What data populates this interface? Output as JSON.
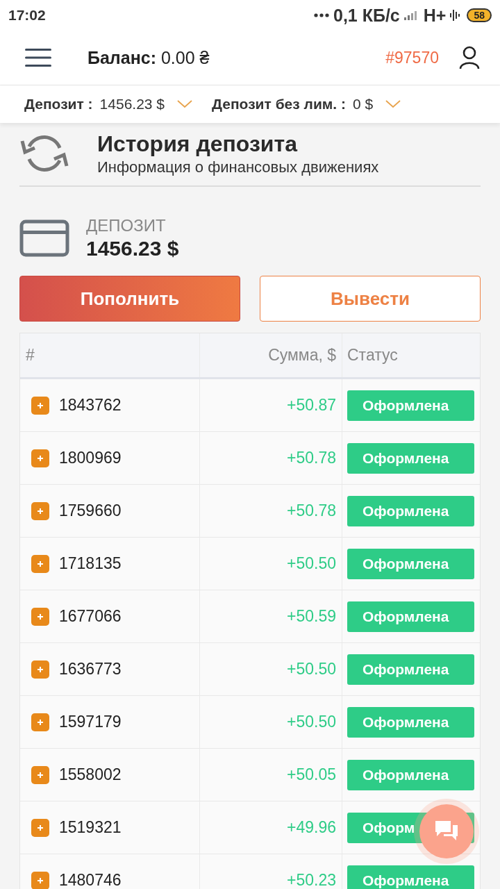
{
  "status_bar": {
    "time": "17:02",
    "speed": "0,1 КБ/с",
    "network": "H+",
    "battery": "58"
  },
  "header": {
    "balance_label": "Баланс:",
    "balance_value": "0.00 ₴",
    "account_id": "#97570"
  },
  "wallets": [
    {
      "label": "Депозит :",
      "value": "1456.23 $"
    },
    {
      "label": "Депозит без лим. :",
      "value": "0 $"
    }
  ],
  "section": {
    "title": "История депозита",
    "subtitle": "Информация о финансовых движениях"
  },
  "deposit": {
    "label": "ДЕПОЗИТ",
    "amount": "1456.23 $"
  },
  "buttons": [
    {
      "label": "Пополнить",
      "kind": "primary"
    },
    {
      "label": "Вывести",
      "kind": "outline"
    }
  ],
  "table": {
    "columns": [
      "#",
      "Сумма, $",
      "Статус"
    ],
    "rows": [
      {
        "id": "1843762",
        "amount": "+50.87",
        "status": "Оформлена"
      },
      {
        "id": "1800969",
        "amount": "+50.78",
        "status": "Оформлена"
      },
      {
        "id": "1759660",
        "amount": "+50.78",
        "status": "Оформлена"
      },
      {
        "id": "1718135",
        "amount": "+50.50",
        "status": "Оформлена"
      },
      {
        "id": "1677066",
        "amount": "+50.59",
        "status": "Оформлена"
      },
      {
        "id": "1636773",
        "amount": "+50.50",
        "status": "Оформлена"
      },
      {
        "id": "1597179",
        "amount": "+50.50",
        "status": "Оформлена"
      },
      {
        "id": "1558002",
        "amount": "+50.05",
        "status": "Оформлена"
      },
      {
        "id": "1519321",
        "amount": "+49.96",
        "status": "Оформ"
      },
      {
        "id": "1480746",
        "amount": "+50.23",
        "status": "Оформлена"
      }
    ]
  }
}
